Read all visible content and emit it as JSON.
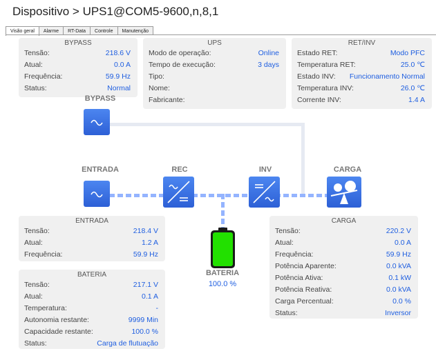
{
  "header": {
    "title": "Dispositivo > UPS1@COM5-9600,n,8,1"
  },
  "tabs": [
    {
      "label": "Visão geral"
    },
    {
      "label": "Alarme"
    },
    {
      "label": "RT-Data"
    },
    {
      "label": "Controle"
    },
    {
      "label": "Manutenção"
    }
  ],
  "bypass_panel": {
    "title": "BYPASS",
    "rows": [
      {
        "k": "Tensão:",
        "v": "218.6 V"
      },
      {
        "k": "Atual:",
        "v": "0.0 A"
      },
      {
        "k": "Frequência:",
        "v": "59.9 Hz"
      },
      {
        "k": "Status:",
        "v": "Normal"
      }
    ]
  },
  "ups_panel": {
    "title": "UPS",
    "rows": [
      {
        "k": "Modo de operação:",
        "v": "Online"
      },
      {
        "k": "Tempo de execução:",
        "v": "3 days"
      },
      {
        "k": "Tipo:",
        "v": ""
      },
      {
        "k": "Nome:",
        "v": ""
      },
      {
        "k": "Fabricante:",
        "v": ""
      }
    ]
  },
  "retinv_panel": {
    "title": "RET/INV",
    "rows": [
      {
        "k": "Estado RET:",
        "v": "Modo PFC"
      },
      {
        "k": "Temperatura RET:",
        "v": "25.0 ℃"
      },
      {
        "k": "Estado INV:",
        "v": "Funcionamento Normal"
      },
      {
        "k": "Temperatura INV:",
        "v": "26.0 ℃"
      },
      {
        "k": "Corrente INV:",
        "v": "1.4 A"
      }
    ]
  },
  "entrada_panel": {
    "title": "ENTRADA",
    "rows": [
      {
        "k": "Tensão:",
        "v": "218.4 V"
      },
      {
        "k": "Atual:",
        "v": "1.2 A"
      },
      {
        "k": "Frequência:",
        "v": "59.9 Hz"
      }
    ]
  },
  "bateria_panel": {
    "title": "BATERIA",
    "rows": [
      {
        "k": "Tensão:",
        "v": "217.1 V"
      },
      {
        "k": "Atual:",
        "v": "0.1 A"
      },
      {
        "k": "Temperatura:",
        "v": "-"
      },
      {
        "k": "Autonomia restante:",
        "v": "9999 Min"
      },
      {
        "k": "Capacidade restante:",
        "v": "100.0 %"
      },
      {
        "k": "Status:",
        "v": "Carga de flutuação"
      }
    ]
  },
  "carga_panel": {
    "title": "CARGA",
    "rows": [
      {
        "k": "Tensão:",
        "v": "220.2 V"
      },
      {
        "k": "Atual:",
        "v": "0.0 A"
      },
      {
        "k": "Frequência:",
        "v": "59.9 Hz"
      },
      {
        "k": "Potência Aparente:",
        "v": "0.0 kVA"
      },
      {
        "k": "Potência Ativa:",
        "v": "0.1 kW"
      },
      {
        "k": "Potência Reativa:",
        "v": "0.0 kVA"
      },
      {
        "k": "Carga Percentual:",
        "v": "0.0 %"
      },
      {
        "k": "Status:",
        "v": "Inversor"
      }
    ]
  },
  "diagram": {
    "bypass_label": "BYPASS",
    "entrada_label": "ENTRADA",
    "rec_label": "REC",
    "inv_label": "INV",
    "carga_label": "CARGA",
    "bateria_label": "BATERIA",
    "battery_percent": "100.0 %",
    "battery_level": 1.0
  },
  "colors": {
    "accent": "#2d60d6",
    "value_text": "#1e5ee0",
    "battery_fill": "#22e000",
    "flow_line": "#94b4ff"
  }
}
